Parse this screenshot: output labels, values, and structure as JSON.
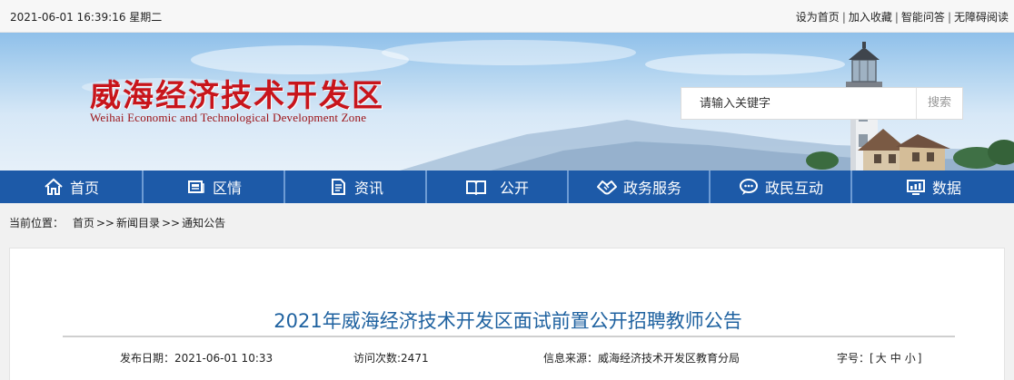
{
  "topbar": {
    "datetime": "2021-06-01 16:39:16 星期二",
    "links": [
      "设为首页",
      "加入收藏",
      "智能问答",
      "无障碍阅读"
    ],
    "separator": "|"
  },
  "header": {
    "logo_cn": "威海经济技术开发区",
    "logo_en": "Weihai Economic and Technological Development Zone",
    "search": {
      "placeholder": "请输入关键字",
      "button": "搜索"
    }
  },
  "nav": {
    "items": [
      {
        "label": "首页",
        "icon": "home-icon"
      },
      {
        "label": "区情",
        "icon": "news-icon"
      },
      {
        "label": "资讯",
        "icon": "document-icon"
      },
      {
        "label": "公开",
        "icon": "book-icon"
      },
      {
        "label": "政务服务",
        "icon": "handshake-icon"
      },
      {
        "label": "政民互动",
        "icon": "chat-icon"
      },
      {
        "label": "数据",
        "icon": "monitor-icon"
      }
    ]
  },
  "breadcrumb": {
    "prefix": "当前位置：",
    "items": [
      "首页",
      "新闻目录",
      "通知公告"
    ],
    "separator": ">>"
  },
  "article": {
    "title": "2021年威海经济技术开发区面试前置公开招聘教师公告",
    "publish_date": "发布日期：2021-06-01 10:33",
    "visits": "访问次数:2471",
    "source": "信息来源：威海经济技术开发区教育分局",
    "font_size_label": "字号：[",
    "font_sizes": [
      "大",
      "中",
      "小"
    ],
    "font_size_close": "]"
  },
  "colors": {
    "nav_bg": "#1d5aa8",
    "logo_red": "#c8151b",
    "title_blue": "#1f62a0"
  }
}
